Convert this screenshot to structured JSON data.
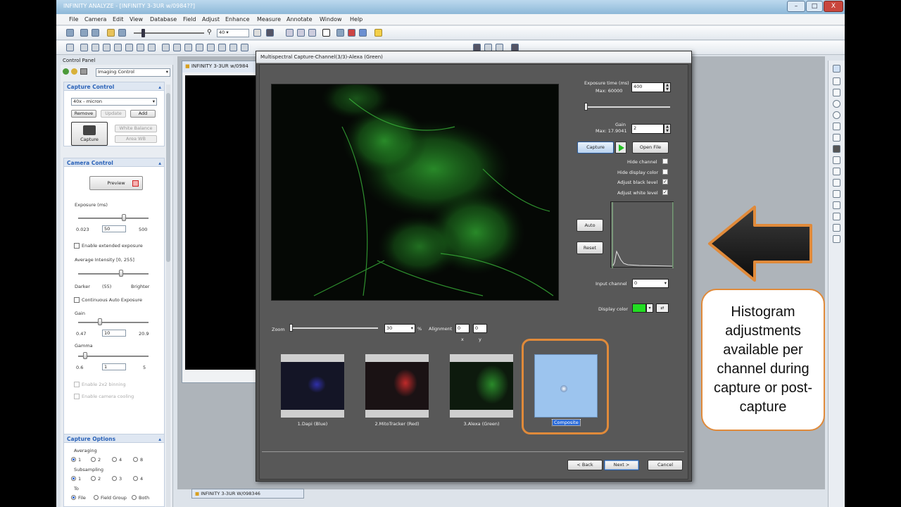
{
  "window": {
    "title": "INFINITY ANALYZE - [INFINITY 3-3UR w/0984??]",
    "minimize": "–",
    "maximize": "□",
    "close": "X"
  },
  "menu": [
    "File",
    "Camera",
    "Edit",
    "View",
    "Database",
    "Field",
    "Adjust",
    "Enhance",
    "Measure",
    "Annotate",
    "Window",
    "Help"
  ],
  "toolbar1": {
    "zoom_value": "40"
  },
  "control_panel": {
    "title": "Control Panel",
    "mode": "Imaging Control",
    "capture_control": {
      "header": "Capture Control",
      "preset": "40x - micron",
      "remove": "Remove",
      "update": "Update",
      "add": "Add",
      "capture": "Capture",
      "white_balance": "White Balance",
      "area_wb": "Area WB"
    },
    "camera_control": {
      "header": "Camera Control",
      "preview": "Preview",
      "exposure_label": "Exposure (ms)",
      "exposure_min": "0.023",
      "exposure_val": "50",
      "exposure_max": "500",
      "extended_exposure": "Enable extended exposure",
      "avg_intensity_label": "Average Intensity [0, 255]",
      "darker": "Darker",
      "intensity_val": "(55)",
      "brighter": "Brighter",
      "continuous_auto": "Continuous Auto Exposure",
      "gain_label": "Gain",
      "gain_min": "0.47",
      "gain_val": "10",
      "gain_max": "20.9",
      "gamma_label": "Gamma",
      "gamma_min": "0.6",
      "gamma_val": "1",
      "gamma_max": "5",
      "binning": "Enable 2x2 binning",
      "cooling": "Enable camera cooling"
    },
    "capture_options": {
      "header": "Capture Options",
      "averaging": "Averaging",
      "averaging_opts": [
        "1",
        "2",
        "4",
        "8"
      ],
      "subsampling": "Subsampling",
      "subsampling_opts": [
        "1",
        "2",
        "3",
        "4"
      ],
      "to_label": "To",
      "to_opts": [
        "File",
        "Field Group",
        "Both"
      ]
    }
  },
  "workspace": {
    "image_tab": "INFINITY 3-3UR w/0984",
    "bottom_tab": "INFINITY 3-3UR W/098346"
  },
  "dialog": {
    "title": "Multispectral Capture-Channel(3/3)-Alexa (Green)",
    "exposure_label": "Exposure time (ms)",
    "exposure_max": "Max: 60000",
    "exposure_value": "400",
    "gain_label": "Gain",
    "gain_max": "Max: 17.9041",
    "gain_value": "2",
    "capture": "Capture",
    "open_file": "Open File",
    "hide_channel": "Hide channel",
    "hide_display_color": "Hide display color",
    "adjust_black": "Adjust black level",
    "adjust_white": "Adjust white level",
    "auto": "Auto",
    "reset": "Reset",
    "input_channel_label": "Input channel",
    "input_channel_value": "0",
    "display_color_label": "Display color",
    "zoom_label": "Zoom",
    "zoom_value": "30",
    "zoom_unit": "%",
    "alignment_label": "Alignment",
    "align_x": "0",
    "align_y": "0",
    "x_label": "x",
    "y_label": "y",
    "thumbnails": [
      {
        "label": "1.Dapi (Blue)"
      },
      {
        "label": "2.MitoTracker (Red)"
      },
      {
        "label": "3.Alexa (Green)"
      },
      {
        "label": "Composite"
      }
    ],
    "back": "< Back",
    "next": "Next >",
    "cancel": "Cancel"
  },
  "annotation": {
    "text": "Histogram adjustments available per channel during capture or post-capture"
  },
  "colors": {
    "accent_orange": "#e08a3a",
    "dialog_bg": "#4f4f4f",
    "composite_blue": "#9cc4ee",
    "display_green": "#22dd22"
  }
}
